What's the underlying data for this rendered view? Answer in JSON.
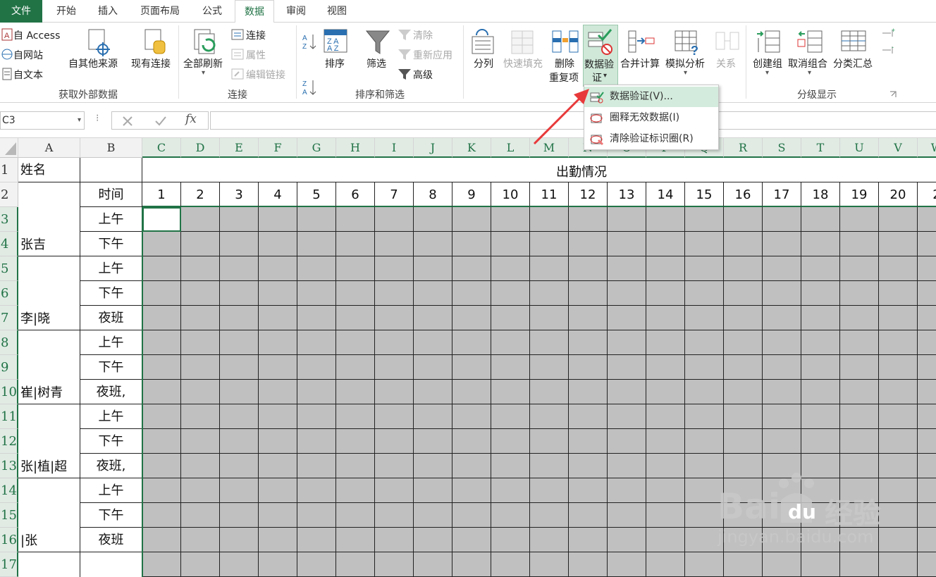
{
  "tabs": [
    {
      "label": "文件"
    },
    {
      "label": "开始"
    },
    {
      "label": "插入"
    },
    {
      "label": "页面布局"
    },
    {
      "label": "公式"
    },
    {
      "label": "数据"
    },
    {
      "label": "审阅"
    },
    {
      "label": "视图"
    }
  ],
  "ribbon": {
    "external": {
      "access": "自 Access",
      "web": "自网站",
      "text": "自文本",
      "other": "自其他来源",
      "existing": "现有连接",
      "group": "获取外部数据"
    },
    "connections": {
      "refresh": "全部刷新",
      "connect": "连接",
      "props": "属性",
      "edit": "编辑链接",
      "group": "连接"
    },
    "sortfilter": {
      "sort": "排序",
      "filter": "筛选",
      "clear": "清除",
      "reapply": "重新应用",
      "advanced": "高级",
      "group": "排序和筛选"
    },
    "tools": {
      "split": "分列",
      "flash": "快速填充",
      "remove1": "删除",
      "remove2": "重复项",
      "validate1": "数据验",
      "validate2": "证",
      "consolidate": "合并计算",
      "whatif": "模拟分析",
      "relations": "关系"
    },
    "outline": {
      "group_btn": "创建组",
      "ungroup": "取消组合",
      "subtotal": "分类汇总",
      "group": "分级显示"
    }
  },
  "formula_bar": {
    "name_box": "C3",
    "fx": "fx"
  },
  "columns": [
    "A",
    "B",
    "C",
    "D",
    "E",
    "F",
    "G",
    "H",
    "I",
    "J",
    "K",
    "L",
    "M",
    "N",
    "O",
    "P",
    "Q",
    "R",
    "S",
    "T",
    "U",
    "V",
    "W"
  ],
  "rows": [
    "1",
    "2",
    "3",
    "4",
    "5",
    "6",
    "7",
    "8",
    "9",
    "10",
    "11",
    "12",
    "13",
    "14",
    "15",
    "16",
    "17"
  ],
  "sheet": {
    "a1": "姓名",
    "b2": "时间",
    "title": "出勤情况",
    "days": [
      "1",
      "2",
      "3",
      "4",
      "5",
      "6",
      "7",
      "8",
      "9",
      "10",
      "11",
      "12",
      "13",
      "14",
      "15",
      "16",
      "17",
      "18",
      "19",
      "20",
      "2"
    ],
    "names": [
      "张吉",
      "李|晓",
      "崔|树青",
      "张|植|超",
      "|张"
    ],
    "times": [
      "上午",
      "下午",
      "上午",
      "下午",
      "夜班",
      "上午",
      "下午",
      "夜班,",
      "上午",
      "下午",
      "夜班,",
      "上午",
      "下午",
      "夜班"
    ]
  },
  "dropdown": {
    "items": [
      "数据验证(V)...",
      "圈释无效数据(I)",
      "清除验证标识圈(R)"
    ]
  },
  "watermark": {
    "brand": "Bai",
    "brand2": "经验",
    "url": "jingyan.baidu.com"
  },
  "colors": {
    "excel_green": "#217346",
    "grey_fill": "#c0c0c0",
    "arrow": "#e8393a"
  }
}
